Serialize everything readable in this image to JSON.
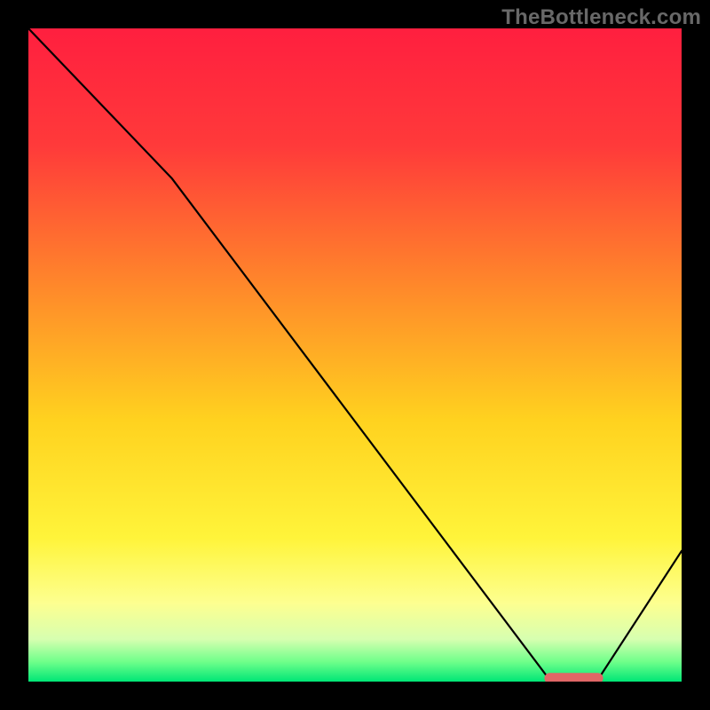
{
  "watermark": "TheBottleneck.com",
  "chart_data": {
    "type": "line",
    "title": "",
    "xlabel": "",
    "ylabel": "",
    "xlim": [
      0,
      100
    ],
    "ylim": [
      0,
      100
    ],
    "series": [
      {
        "name": "curve",
        "x": [
          0,
          22,
          80,
          87,
          100
        ],
        "values": [
          100,
          77,
          0,
          0,
          20
        ]
      }
    ],
    "marker": {
      "name": "optimal-range",
      "x_start": 79,
      "x_end": 88,
      "y": 0.5,
      "color": "#e06666"
    },
    "background_gradient_stops": [
      {
        "pos": 0.0,
        "color": "#ff1f3f"
      },
      {
        "pos": 0.18,
        "color": "#ff3a3a"
      },
      {
        "pos": 0.4,
        "color": "#ff8a2a"
      },
      {
        "pos": 0.6,
        "color": "#ffd21f"
      },
      {
        "pos": 0.78,
        "color": "#fff43a"
      },
      {
        "pos": 0.88,
        "color": "#fdff90"
      },
      {
        "pos": 0.935,
        "color": "#d7ffb0"
      },
      {
        "pos": 0.97,
        "color": "#6eff8a"
      },
      {
        "pos": 1.0,
        "color": "#00e676"
      }
    ]
  }
}
